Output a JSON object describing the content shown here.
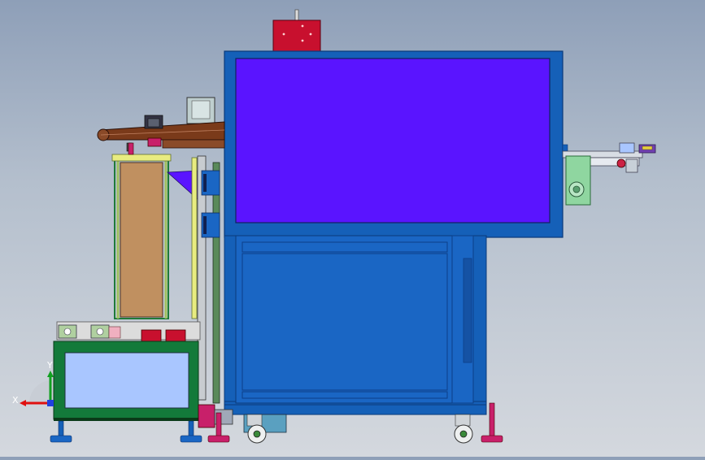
{
  "app": {
    "title": "",
    "view": "front"
  },
  "colors": {
    "frame_blue": "#1560b8",
    "panel_purple": "#5a14ff",
    "door_blue": "#1a66c4",
    "base_green": "#137a3a",
    "glass_light": "#a9c6ff",
    "motor_red": "#c8102e",
    "wood_brown": "#c09060",
    "belt_brown": "#7a3a1a",
    "caster_pink": "#c8206a",
    "feeder_green": "#8fd6a0",
    "background_top": "#8e9fb8",
    "background_bottom": "#d4d8de"
  },
  "triad": {
    "x_label": "X",
    "y_label": "Y"
  },
  "icons": {
    "axis_triad": "axis-triad-icon",
    "caster": "caster-wheel-icon",
    "leveling_foot": "leveling-foot-icon",
    "motor": "motor-icon"
  }
}
